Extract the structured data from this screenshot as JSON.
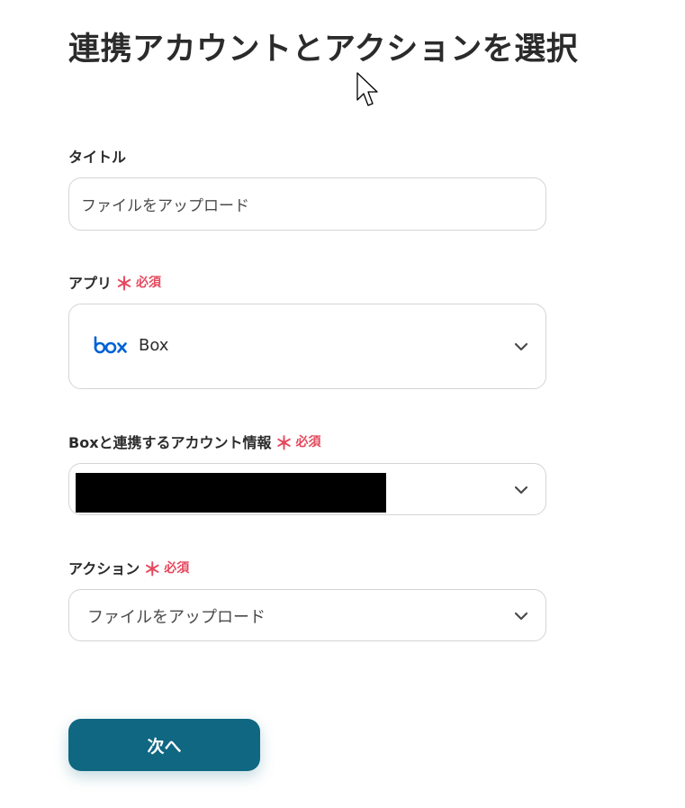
{
  "page": {
    "title": "連携アカウントとアクションを選択"
  },
  "form": {
    "title_field": {
      "label": "タイトル",
      "value": "ファイルをアップロード"
    },
    "app_field": {
      "label": "アプリ",
      "required_mark": "＊",
      "required_text": "必須",
      "selected_app": "Box",
      "app_icon": "box-logo-icon"
    },
    "account_field": {
      "label": "Boxと連携するアカウント情報",
      "required_mark": "＊",
      "required_text": "必須"
    },
    "action_field": {
      "label": "アクション",
      "required_mark": "＊",
      "required_text": "必須",
      "selected_action": "ファイルをアップロード"
    }
  },
  "buttons": {
    "next_label": "次へ"
  },
  "colors": {
    "primary_button": "#0f6781",
    "required": "#e5485d",
    "box_brand": "#0061d5",
    "border": "#d4d4d8"
  }
}
